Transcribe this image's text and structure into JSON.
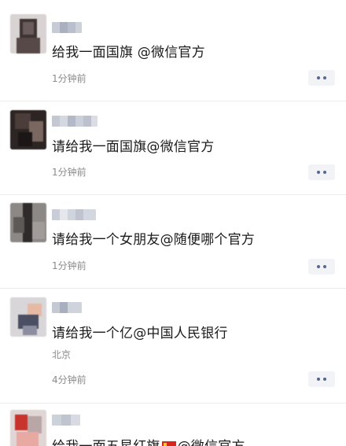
{
  "posts": [
    {
      "content": "给我一面国旗 @微信官方",
      "location": "",
      "time": "1分钟前"
    },
    {
      "content": "请给我一面国旗@微信官方",
      "location": "",
      "time": "1分钟前"
    },
    {
      "content": "请给我一个女朋友@随便哪个官方",
      "location": "",
      "time": "1分钟前"
    },
    {
      "content": "请给我一个亿@中国人民银行",
      "location": "北京",
      "time": "4分钟前"
    },
    {
      "content_before_emoji": "给我一面五星红旗",
      "emoji": "flag-cn",
      "content_after_emoji": "@微信官方",
      "location": "",
      "time": ""
    }
  ],
  "icons": {
    "more": "more-dots-icon",
    "avatar": "blurred-avatar"
  },
  "colors": {
    "text": "#1b1b1b",
    "meta": "#8a8a8a",
    "more_button_bg": "#f1f3f6",
    "more_dots": "#55698f",
    "divider": "#ececec"
  }
}
